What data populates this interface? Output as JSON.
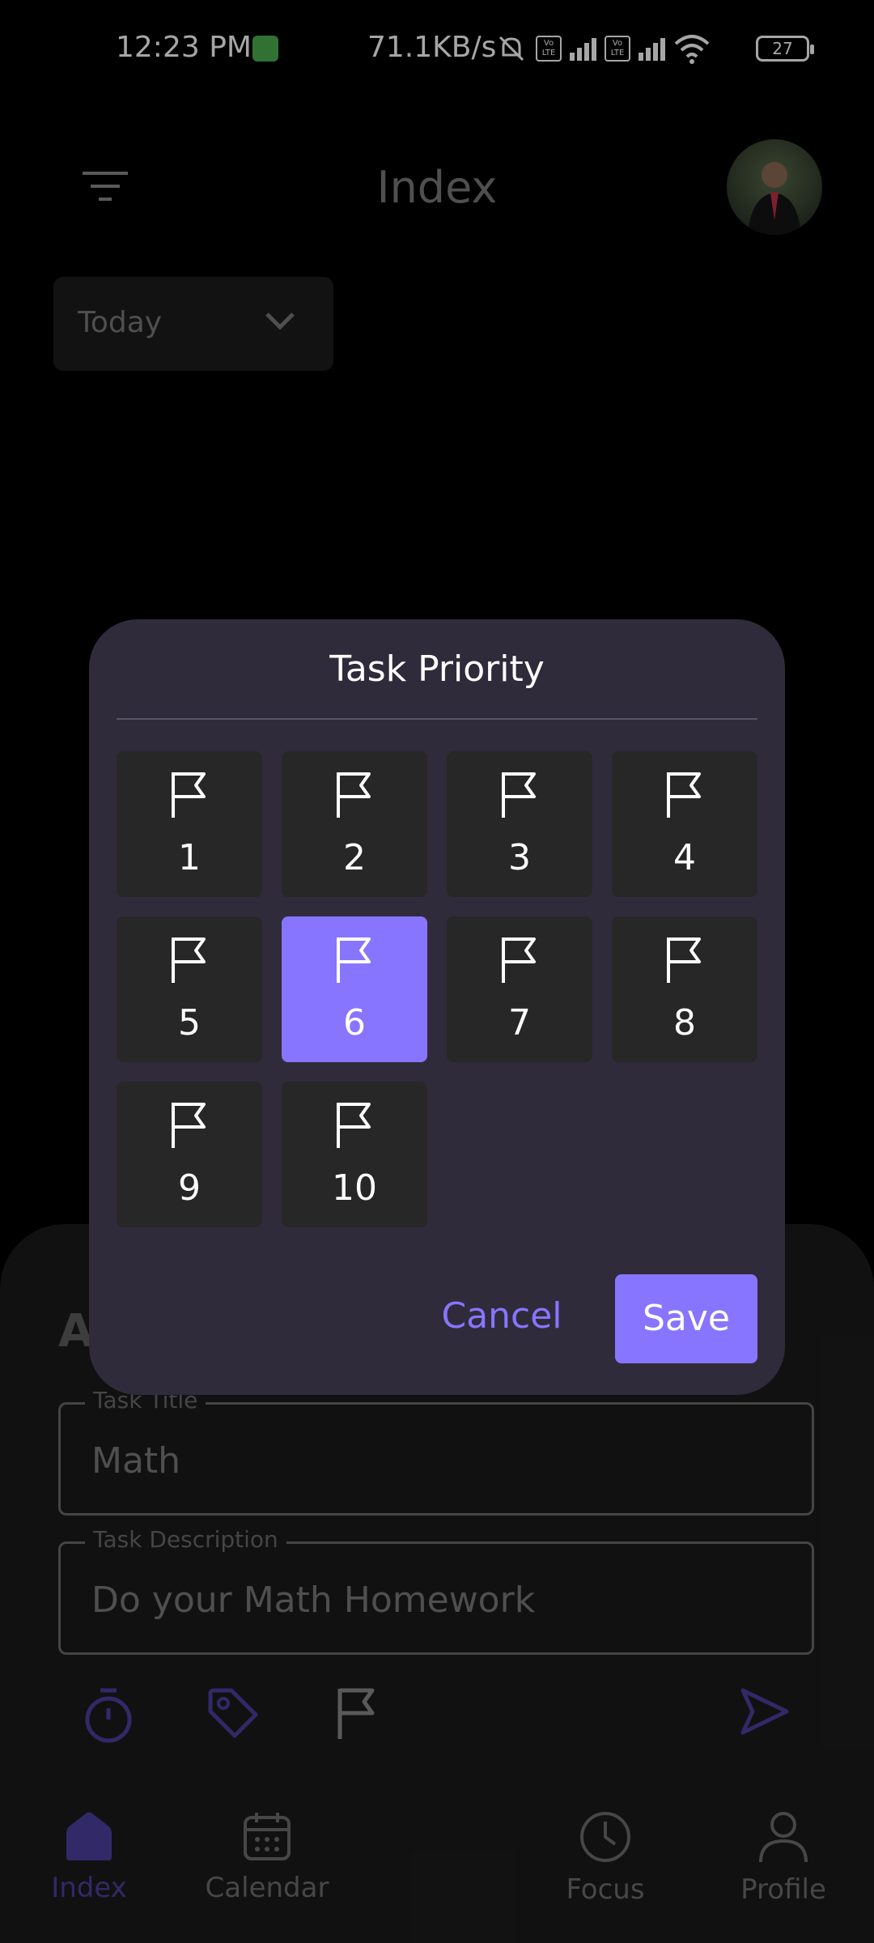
{
  "status_bar": {
    "time": "12:23 PM",
    "network_speed": "71.1KB/s",
    "volte_label": "Vo\nLTE",
    "battery": "27"
  },
  "header": {
    "title": "Index",
    "menu_icon": "filter-menu-icon",
    "avatar_icon": "user-avatar"
  },
  "filter": {
    "selected": "Today"
  },
  "add_task_sheet": {
    "heading_visible_fragment": "A",
    "fields": [
      {
        "label": "Task Title",
        "value": "Math"
      },
      {
        "label": "Task Description",
        "value": "Do your Math Homework"
      }
    ],
    "action_icons": [
      "timer-icon",
      "tag-icon",
      "flag-icon",
      "send-icon"
    ]
  },
  "priority_dialog": {
    "title": "Task Priority",
    "options": [
      "1",
      "2",
      "3",
      "4",
      "5",
      "6",
      "7",
      "8",
      "9",
      "10"
    ],
    "selected": "6",
    "cancel_label": "Cancel",
    "save_label": "Save"
  },
  "bottom_nav": {
    "items": [
      {
        "label": "Index",
        "icon": "home-icon",
        "active": true
      },
      {
        "label": "Calendar",
        "icon": "calendar-icon",
        "active": false
      },
      {
        "label": "Focus",
        "icon": "clock-icon",
        "active": false
      },
      {
        "label": "Profile",
        "icon": "person-icon",
        "active": false
      }
    ]
  },
  "colors": {
    "accent": "#8875ff",
    "dialog_bg": "#302b3b",
    "cell_bg": "#272727",
    "nav_active": "#4c3fa0"
  }
}
